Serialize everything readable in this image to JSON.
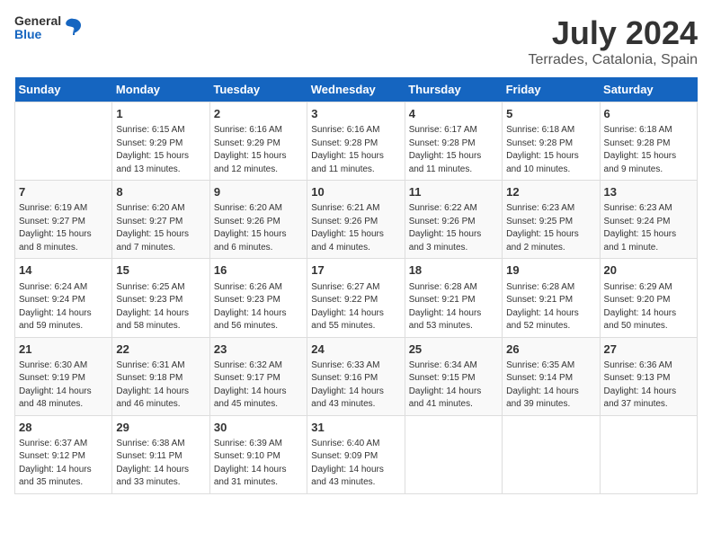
{
  "header": {
    "logo": {
      "general": "General",
      "blue": "Blue"
    },
    "title": "July 2024",
    "location": "Terrades, Catalonia, Spain"
  },
  "columns": [
    "Sunday",
    "Monday",
    "Tuesday",
    "Wednesday",
    "Thursday",
    "Friday",
    "Saturday"
  ],
  "weeks": [
    [
      {
        "day": "",
        "sunrise": "",
        "sunset": "",
        "daylight": ""
      },
      {
        "day": "1",
        "sunrise": "Sunrise: 6:15 AM",
        "sunset": "Sunset: 9:29 PM",
        "daylight": "Daylight: 15 hours and 13 minutes."
      },
      {
        "day": "2",
        "sunrise": "Sunrise: 6:16 AM",
        "sunset": "Sunset: 9:29 PM",
        "daylight": "Daylight: 15 hours and 12 minutes."
      },
      {
        "day": "3",
        "sunrise": "Sunrise: 6:16 AM",
        "sunset": "Sunset: 9:28 PM",
        "daylight": "Daylight: 15 hours and 11 minutes."
      },
      {
        "day": "4",
        "sunrise": "Sunrise: 6:17 AM",
        "sunset": "Sunset: 9:28 PM",
        "daylight": "Daylight: 15 hours and 11 minutes."
      },
      {
        "day": "5",
        "sunrise": "Sunrise: 6:18 AM",
        "sunset": "Sunset: 9:28 PM",
        "daylight": "Daylight: 15 hours and 10 minutes."
      },
      {
        "day": "6",
        "sunrise": "Sunrise: 6:18 AM",
        "sunset": "Sunset: 9:28 PM",
        "daylight": "Daylight: 15 hours and 9 minutes."
      }
    ],
    [
      {
        "day": "7",
        "sunrise": "Sunrise: 6:19 AM",
        "sunset": "Sunset: 9:27 PM",
        "daylight": "Daylight: 15 hours and 8 minutes."
      },
      {
        "day": "8",
        "sunrise": "Sunrise: 6:20 AM",
        "sunset": "Sunset: 9:27 PM",
        "daylight": "Daylight: 15 hours and 7 minutes."
      },
      {
        "day": "9",
        "sunrise": "Sunrise: 6:20 AM",
        "sunset": "Sunset: 9:26 PM",
        "daylight": "Daylight: 15 hours and 6 minutes."
      },
      {
        "day": "10",
        "sunrise": "Sunrise: 6:21 AM",
        "sunset": "Sunset: 9:26 PM",
        "daylight": "Daylight: 15 hours and 4 minutes."
      },
      {
        "day": "11",
        "sunrise": "Sunrise: 6:22 AM",
        "sunset": "Sunset: 9:26 PM",
        "daylight": "Daylight: 15 hours and 3 minutes."
      },
      {
        "day": "12",
        "sunrise": "Sunrise: 6:23 AM",
        "sunset": "Sunset: 9:25 PM",
        "daylight": "Daylight: 15 hours and 2 minutes."
      },
      {
        "day": "13",
        "sunrise": "Sunrise: 6:23 AM",
        "sunset": "Sunset: 9:24 PM",
        "daylight": "Daylight: 15 hours and 1 minute."
      }
    ],
    [
      {
        "day": "14",
        "sunrise": "Sunrise: 6:24 AM",
        "sunset": "Sunset: 9:24 PM",
        "daylight": "Daylight: 14 hours and 59 minutes."
      },
      {
        "day": "15",
        "sunrise": "Sunrise: 6:25 AM",
        "sunset": "Sunset: 9:23 PM",
        "daylight": "Daylight: 14 hours and 58 minutes."
      },
      {
        "day": "16",
        "sunrise": "Sunrise: 6:26 AM",
        "sunset": "Sunset: 9:23 PM",
        "daylight": "Daylight: 14 hours and 56 minutes."
      },
      {
        "day": "17",
        "sunrise": "Sunrise: 6:27 AM",
        "sunset": "Sunset: 9:22 PM",
        "daylight": "Daylight: 14 hours and 55 minutes."
      },
      {
        "day": "18",
        "sunrise": "Sunrise: 6:28 AM",
        "sunset": "Sunset: 9:21 PM",
        "daylight": "Daylight: 14 hours and 53 minutes."
      },
      {
        "day": "19",
        "sunrise": "Sunrise: 6:28 AM",
        "sunset": "Sunset: 9:21 PM",
        "daylight": "Daylight: 14 hours and 52 minutes."
      },
      {
        "day": "20",
        "sunrise": "Sunrise: 6:29 AM",
        "sunset": "Sunset: 9:20 PM",
        "daylight": "Daylight: 14 hours and 50 minutes."
      }
    ],
    [
      {
        "day": "21",
        "sunrise": "Sunrise: 6:30 AM",
        "sunset": "Sunset: 9:19 PM",
        "daylight": "Daylight: 14 hours and 48 minutes."
      },
      {
        "day": "22",
        "sunrise": "Sunrise: 6:31 AM",
        "sunset": "Sunset: 9:18 PM",
        "daylight": "Daylight: 14 hours and 46 minutes."
      },
      {
        "day": "23",
        "sunrise": "Sunrise: 6:32 AM",
        "sunset": "Sunset: 9:17 PM",
        "daylight": "Daylight: 14 hours and 45 minutes."
      },
      {
        "day": "24",
        "sunrise": "Sunrise: 6:33 AM",
        "sunset": "Sunset: 9:16 PM",
        "daylight": "Daylight: 14 hours and 43 minutes."
      },
      {
        "day": "25",
        "sunrise": "Sunrise: 6:34 AM",
        "sunset": "Sunset: 9:15 PM",
        "daylight": "Daylight: 14 hours and 41 minutes."
      },
      {
        "day": "26",
        "sunrise": "Sunrise: 6:35 AM",
        "sunset": "Sunset: 9:14 PM",
        "daylight": "Daylight: 14 hours and 39 minutes."
      },
      {
        "day": "27",
        "sunrise": "Sunrise: 6:36 AM",
        "sunset": "Sunset: 9:13 PM",
        "daylight": "Daylight: 14 hours and 37 minutes."
      }
    ],
    [
      {
        "day": "28",
        "sunrise": "Sunrise: 6:37 AM",
        "sunset": "Sunset: 9:12 PM",
        "daylight": "Daylight: 14 hours and 35 minutes."
      },
      {
        "day": "29",
        "sunrise": "Sunrise: 6:38 AM",
        "sunset": "Sunset: 9:11 PM",
        "daylight": "Daylight: 14 hours and 33 minutes."
      },
      {
        "day": "30",
        "sunrise": "Sunrise: 6:39 AM",
        "sunset": "Sunset: 9:10 PM",
        "daylight": "Daylight: 14 hours and 31 minutes."
      },
      {
        "day": "31",
        "sunrise": "Sunrise: 6:40 AM",
        "sunset": "Sunset: 9:09 PM",
        "daylight": "Daylight: 14 hours and 43 minutes."
      },
      {
        "day": "",
        "sunrise": "",
        "sunset": "",
        "daylight": ""
      },
      {
        "day": "",
        "sunrise": "",
        "sunset": "",
        "daylight": ""
      },
      {
        "day": "",
        "sunrise": "",
        "sunset": "",
        "daylight": ""
      }
    ]
  ]
}
